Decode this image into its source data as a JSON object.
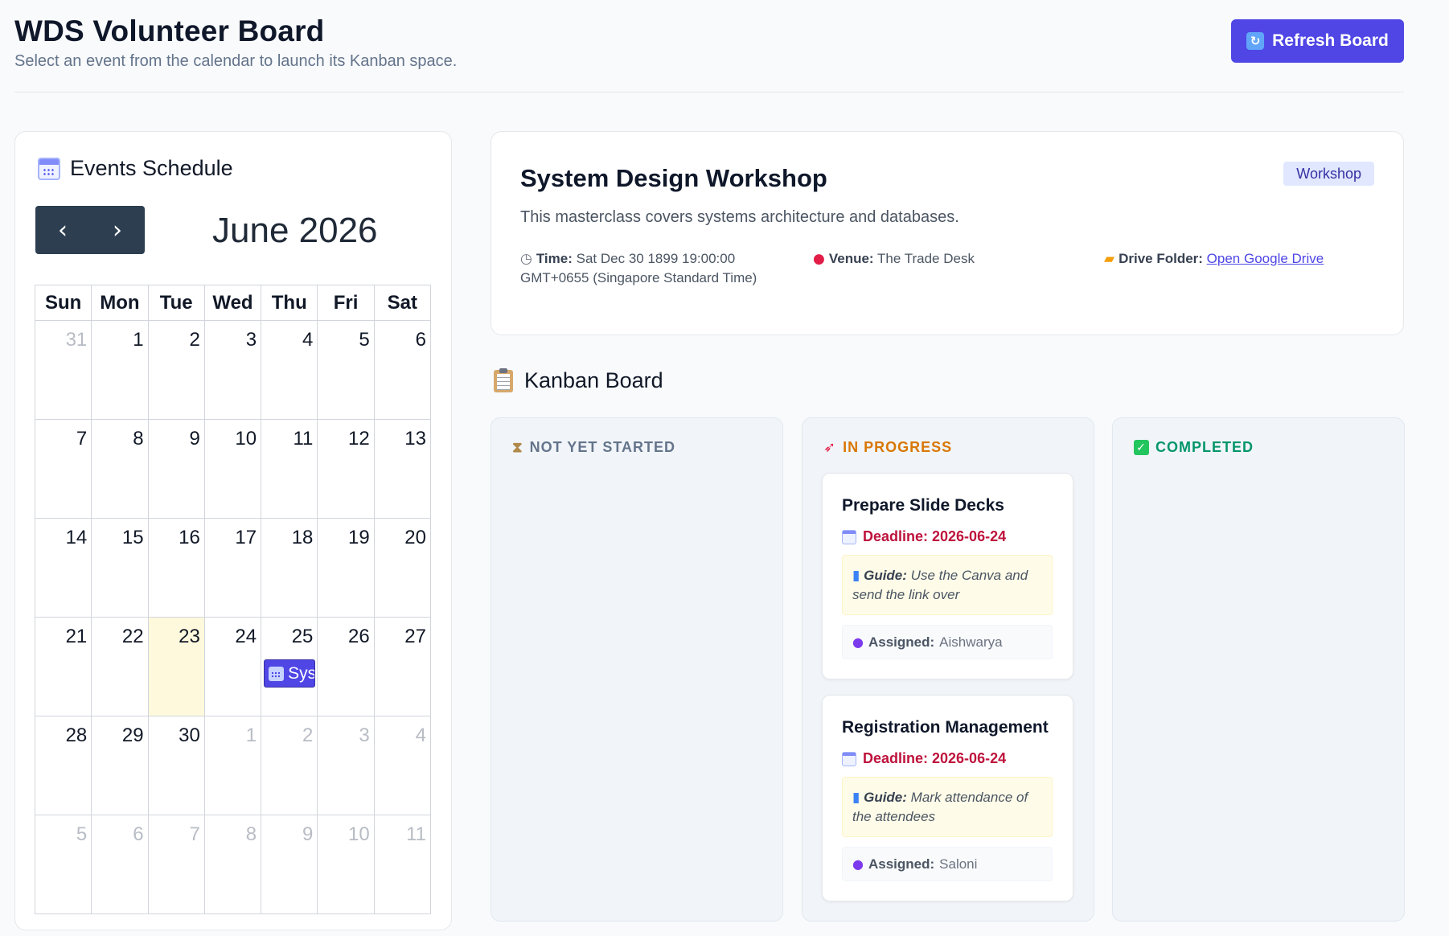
{
  "header": {
    "title": "WDS Volunteer Board",
    "subtitle": "Select an event from the calendar to launch its Kanban space.",
    "refresh_label": "Refresh Board",
    "refresh_icon": "refresh-icon"
  },
  "calendar": {
    "heading": "Events Schedule",
    "prev_label": "‹",
    "next_label": "›",
    "month_title": "June 2026",
    "weekdays": [
      "Sun",
      "Mon",
      "Tue",
      "Wed",
      "Thu",
      "Fri",
      "Sat"
    ],
    "weeks": [
      [
        {
          "d": "31",
          "other": true
        },
        {
          "d": "1"
        },
        {
          "d": "2"
        },
        {
          "d": "3"
        },
        {
          "d": "4"
        },
        {
          "d": "5"
        },
        {
          "d": "6"
        }
      ],
      [
        {
          "d": "7"
        },
        {
          "d": "8"
        },
        {
          "d": "9"
        },
        {
          "d": "10"
        },
        {
          "d": "11"
        },
        {
          "d": "12"
        },
        {
          "d": "13"
        }
      ],
      [
        {
          "d": "14"
        },
        {
          "d": "15"
        },
        {
          "d": "16"
        },
        {
          "d": "17"
        },
        {
          "d": "18"
        },
        {
          "d": "19"
        },
        {
          "d": "20"
        }
      ],
      [
        {
          "d": "21"
        },
        {
          "d": "22"
        },
        {
          "d": "23",
          "today": true
        },
        {
          "d": "24"
        },
        {
          "d": "25",
          "event": "Sys"
        },
        {
          "d": "26"
        },
        {
          "d": "27"
        }
      ],
      [
        {
          "d": "28"
        },
        {
          "d": "29"
        },
        {
          "d": "30"
        },
        {
          "d": "1",
          "other": true
        },
        {
          "d": "2",
          "other": true
        },
        {
          "d": "3",
          "other": true
        },
        {
          "d": "4",
          "other": true
        }
      ],
      [
        {
          "d": "5",
          "other": true
        },
        {
          "d": "6",
          "other": true
        },
        {
          "d": "7",
          "other": true
        },
        {
          "d": "8",
          "other": true
        },
        {
          "d": "9",
          "other": true
        },
        {
          "d": "10",
          "other": true
        },
        {
          "d": "11",
          "other": true
        }
      ]
    ],
    "today_color": "#fef9dc",
    "event_color": "#4f46e5"
  },
  "event": {
    "title": "System Design Workshop",
    "badge": "Workshop",
    "description": "This masterclass covers systems architecture and databases.",
    "time_label": "Time:",
    "time_value": "Sat Dec 30 1899 19:00:00 GMT+0655 (Singapore Standard Time)",
    "venue_label": "Venue:",
    "venue_value": "The Trade Desk",
    "drive_label": "Drive Folder:",
    "drive_link": "Open Google Drive"
  },
  "kanban": {
    "heading": "Kanban Board",
    "columns": [
      {
        "title": "NOT YET STARTED",
        "icon": "hourglass-icon",
        "color": "#64748b"
      },
      {
        "title": "IN PROGRESS",
        "icon": "rocket-icon",
        "color": "#d97706"
      },
      {
        "title": "COMPLETED",
        "icon": "check-icon",
        "color": "#059669"
      }
    ],
    "tasks": [
      {
        "title": "Prepare Slide Decks",
        "deadline": "Deadline: 2026-06-24",
        "guide_label": "Guide:",
        "guide_text": "Use the Canva and send the link over",
        "assigned_label": "Assigned:",
        "assigned_value": "Aishwarya"
      },
      {
        "title": "Registration Management",
        "deadline": "Deadline: 2026-06-24",
        "guide_label": "Guide:",
        "guide_text": "Mark attendance of the attendees",
        "assigned_label": "Assigned:",
        "assigned_value": "Saloni"
      }
    ]
  }
}
